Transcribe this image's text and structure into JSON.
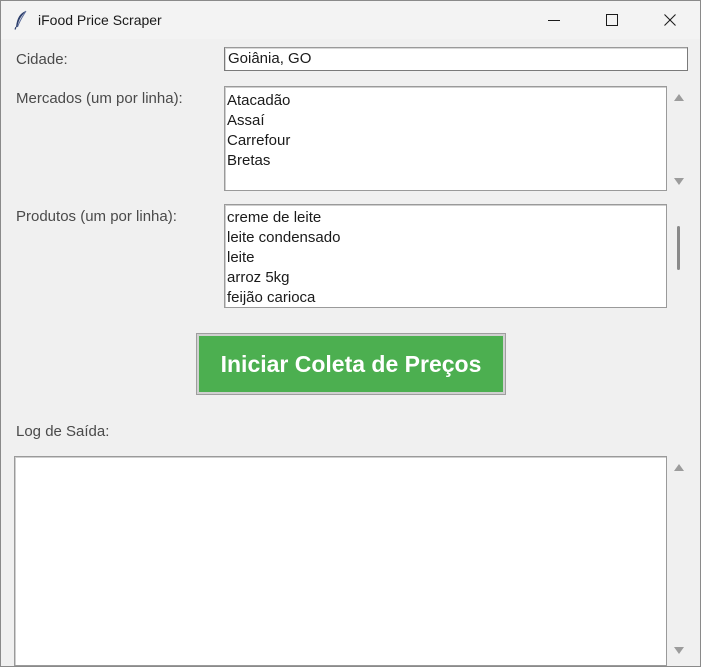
{
  "window": {
    "title": "iFood Price Scraper",
    "icon": "feather-icon",
    "controls": [
      "minimize-icon",
      "maximize-icon",
      "close-icon"
    ]
  },
  "form": {
    "city_label": "Cidade:",
    "city_value": "Goiânia, GO",
    "markets_label": "Mercados (um por linha):",
    "markets": [
      "Atacadão",
      "Assaí",
      "Carrefour",
      "Bretas"
    ],
    "products_label": "Produtos (um por linha):",
    "products": [
      "creme de leite",
      "leite condensado",
      "leite",
      "arroz 5kg",
      "feijão carioca"
    ]
  },
  "actions": {
    "start_label": "Iniciar Coleta de Preços",
    "start_color": "#4caf50"
  },
  "log": {
    "label": "Log de Saída:",
    "lines": []
  }
}
